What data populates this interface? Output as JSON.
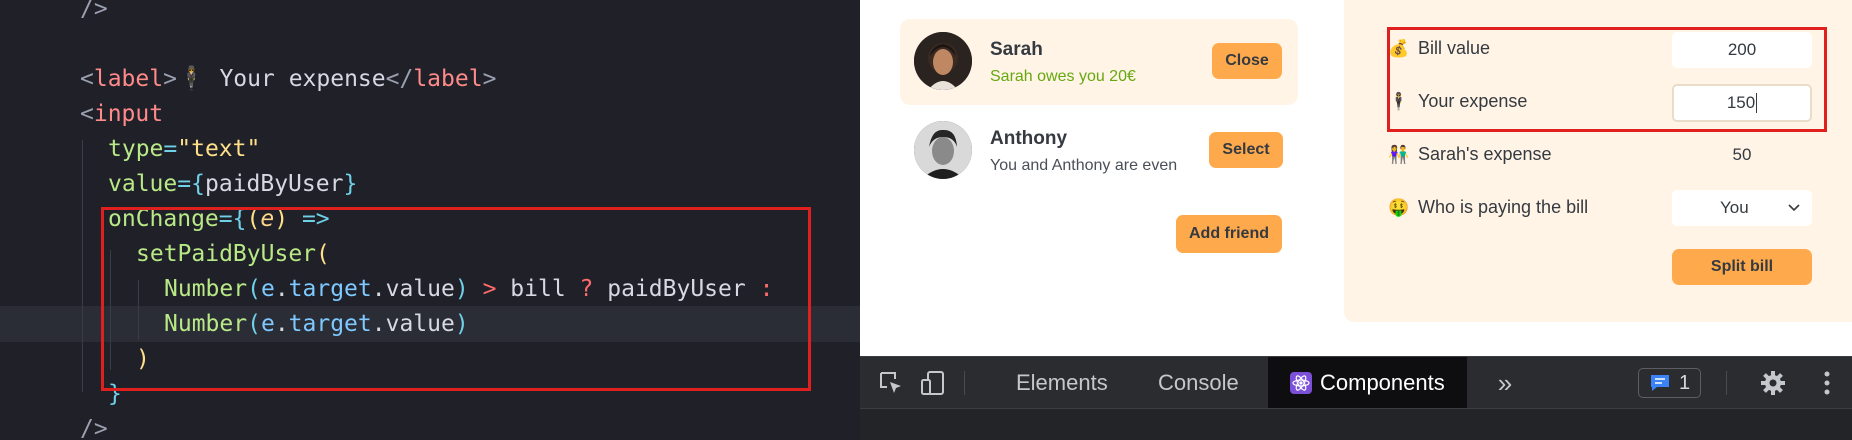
{
  "editor": {
    "lines": [
      {
        "indent": 0,
        "tokens": [
          [
            "mute",
            "/>"
          ]
        ]
      },
      {
        "indent": 0,
        "tokens": []
      },
      {
        "indent": 0,
        "tokens": [
          [
            "br",
            "<"
          ],
          [
            "tag",
            "label"
          ],
          [
            "br",
            ">"
          ],
          [
            "var",
            "🕴 Your expense"
          ],
          [
            "br",
            "</"
          ],
          [
            "tag",
            "label"
          ],
          [
            "br",
            ">"
          ]
        ]
      },
      {
        "indent": 0,
        "tokens": [
          [
            "br",
            "<"
          ],
          [
            "tag",
            "input"
          ]
        ]
      },
      {
        "indent": 1,
        "tokens": [
          [
            "attr",
            "type"
          ],
          [
            "op",
            "="
          ],
          [
            "str",
            "\"text\""
          ]
        ]
      },
      {
        "indent": 1,
        "tokens": [
          [
            "attr",
            "value"
          ],
          [
            "op",
            "="
          ],
          [
            "op",
            "{"
          ],
          [
            "var",
            "paidByUser"
          ],
          [
            "op",
            "}"
          ]
        ]
      },
      {
        "indent": 1,
        "tokens": [
          [
            "attr",
            "onChange"
          ],
          [
            "op",
            "="
          ],
          [
            "op",
            "{"
          ],
          [
            "str",
            "("
          ],
          [
            "param",
            "e"
          ],
          [
            "str",
            ")"
          ],
          [
            "var",
            " "
          ],
          [
            "op",
            "=>"
          ]
        ]
      },
      {
        "indent": 2,
        "tokens": [
          [
            "fn",
            "setPaidByUser"
          ],
          [
            "str",
            "("
          ]
        ]
      },
      {
        "indent": 3,
        "tokens": [
          [
            "fn",
            "Number"
          ],
          [
            "op",
            "("
          ],
          [
            "prop",
            "e"
          ],
          [
            "var",
            "."
          ],
          [
            "prop",
            "target"
          ],
          [
            "var",
            ".value"
          ],
          [
            "op",
            ")"
          ],
          [
            "var",
            " "
          ],
          [
            "red-op",
            ">"
          ],
          [
            "var",
            " bill "
          ],
          [
            "red-op",
            "?"
          ],
          [
            "var",
            " paidByUser "
          ],
          [
            "red-op",
            ":"
          ]
        ]
      },
      {
        "indent": 3,
        "tokens": [
          [
            "fn",
            "Number"
          ],
          [
            "op",
            "("
          ],
          [
            "prop",
            "e"
          ],
          [
            "var",
            "."
          ],
          [
            "prop",
            "target"
          ],
          [
            "var",
            ".value"
          ],
          [
            "op",
            ")"
          ]
        ]
      },
      {
        "indent": 2,
        "tokens": [
          [
            "str",
            ")"
          ]
        ]
      },
      {
        "indent": 1,
        "tokens": [
          [
            "op",
            "}"
          ]
        ]
      },
      {
        "indent": 0,
        "tokens": [
          [
            "mute",
            "/>"
          ]
        ]
      }
    ]
  },
  "friends": [
    {
      "name": "Sarah",
      "status": "Sarah owes you 20€",
      "status_type": "owes",
      "button": "Close",
      "active": true
    },
    {
      "name": "Anthony",
      "status": "You and Anthony are even",
      "status_type": "even",
      "button": "Select",
      "active": false
    }
  ],
  "add_friend_label": "Add friend",
  "split_form": {
    "bill_value": {
      "icon": "💰",
      "label": "Bill value",
      "value": "200"
    },
    "your_expense": {
      "icon": "🕴",
      "label": "Your expense",
      "value": "150"
    },
    "friend_expense": {
      "icon": "👫",
      "label": "Sarah's expense",
      "value": "50"
    },
    "who_pays": {
      "icon": "🤑",
      "label": "Who is paying the bill",
      "value": "You"
    },
    "submit_label": "Split bill"
  },
  "devtools": {
    "tabs": [
      "Elements",
      "Console",
      "Components"
    ],
    "active_tab": "Components",
    "message_count": "1"
  },
  "colors": {
    "accent": "#ffa94d",
    "panel": "#fff4e6",
    "highlight": "#e0201f",
    "owes_green": "#66a80f"
  }
}
